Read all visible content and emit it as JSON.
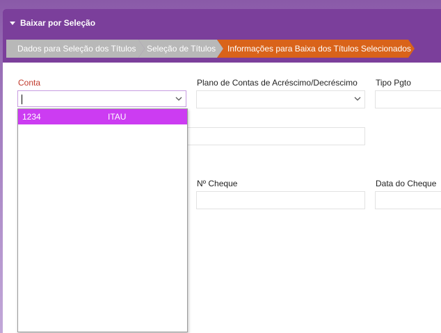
{
  "panel": {
    "title": "Baixar por Seleção"
  },
  "wizard": {
    "steps": [
      {
        "label": "Dados para Seleção dos Títulos",
        "state": "done"
      },
      {
        "label": "Seleção de Títulos",
        "state": "done"
      },
      {
        "label": "Informações para Baixa dos Títulos Selecionados",
        "state": "active"
      }
    ]
  },
  "form": {
    "conta_label": "Conta",
    "conta_value": "",
    "plano_label": "Plano de Contas de Acréscimo/Decréscimo",
    "plano_value": "",
    "tipo_pgto_label": "Tipo Pgto",
    "tipo_pgto_value": "",
    "unlabeled_field_value": "",
    "cheque_label": "Nº Cheque",
    "cheque_value": "",
    "data_cheque_label": "Data do Cheque",
    "data_cheque_value": ""
  },
  "dropdown": {
    "options": [
      {
        "code": "1234",
        "name": "ITAU",
        "highlighted": true
      }
    ]
  },
  "colors": {
    "header_bg": "#7b3f9b",
    "step_done": "#b8b8b8",
    "step_active": "#d9631a",
    "option_highlight": "#cc3cf2",
    "required_label": "#c0392b"
  },
  "icons": {
    "collapse": "caret-down-icon",
    "select_arrow": "chevron-down-icon"
  }
}
